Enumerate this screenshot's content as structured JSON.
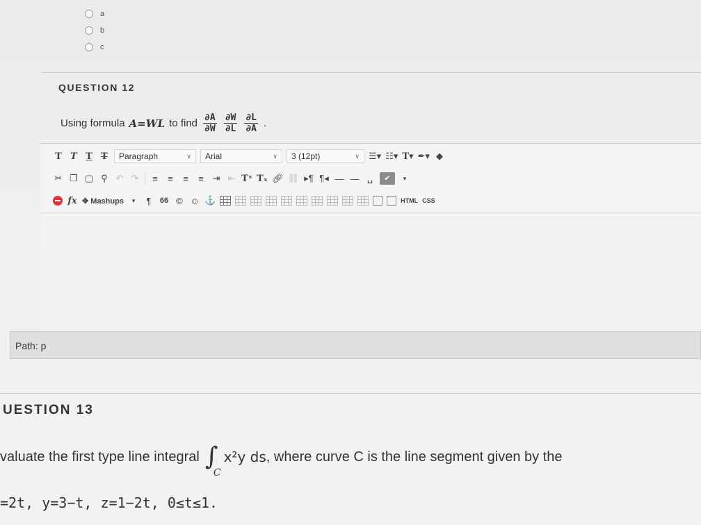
{
  "options": [
    "a",
    "b",
    "c"
  ],
  "q12": {
    "heading": "QUESTION 12",
    "text_prefix": "Using formula",
    "formula": "A=WL",
    "text_mid": "to find",
    "fractions": [
      {
        "num": "∂A",
        "den": "∂W"
      },
      {
        "num": "∂W",
        "den": "∂L"
      },
      {
        "num": "∂L",
        "den": "∂A"
      }
    ],
    "end_punct": "."
  },
  "editor": {
    "row1": {
      "t1": "T",
      "t2": "T",
      "t3": "T",
      "t4": "T",
      "paragraph": "Paragraph",
      "font": "Arial",
      "size": "3 (12pt)"
    },
    "row2": {
      "superscript": "Tˣ",
      "subscript": "Tₓ"
    },
    "row3": {
      "mashups": "Mashups",
      "pilcrow": "¶",
      "quote": "66",
      "html": "HTML",
      "css": "CSS"
    },
    "path_label": "Path: p"
  },
  "q13": {
    "heading": "UESTION 13",
    "text_prefix": "valuate the first type line integral",
    "integrand": "x²y ds",
    "integral_sub": "C",
    "text_suffix": ", where curve C is the line segment given by the",
    "equations": "=2t,  y=3−t,  z=1−2t,  0≤t≤1."
  }
}
